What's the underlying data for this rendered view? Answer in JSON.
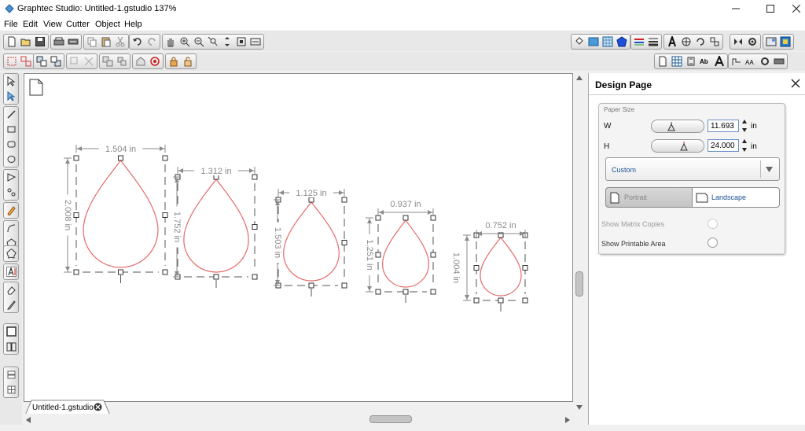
{
  "window": {
    "title": "Graphtec Studio: Untitled-1.gstudio 137%"
  },
  "menu": [
    "File",
    "Edit",
    "View",
    "Cutter",
    "Object",
    "Help"
  ],
  "document": {
    "tab_label": "Untitled-1.gstudio"
  },
  "panel": {
    "title": "Design Page",
    "paper_size_label": "Paper Size",
    "width_label": "W",
    "width_value": "11.693",
    "height_label": "H",
    "height_value": "24.000",
    "unit": "in",
    "preset": "Custom",
    "orientation": {
      "portrait": "Portrait",
      "landscape": "Landscape",
      "selected": "Portrait"
    },
    "show_matrix_copies": "Show Matrix Copies",
    "show_printable_area": "Show Printable Area"
  },
  "shapes": [
    {
      "width_label": "1.504 in",
      "height_label": "2.008 in"
    },
    {
      "width_label": "1.312 in",
      "height_label": "1.752 in"
    },
    {
      "width_label": "1.125 in",
      "height_label": "1.503 in"
    },
    {
      "width_label": "0.937 in",
      "height_label": "1.251 in"
    },
    {
      "width_label": "0.752 in",
      "height_label": "1.004 in"
    }
  ],
  "colors": {
    "shape_stroke": "#e56a6a",
    "dimension_text": "#8a8a8a",
    "accent": "#0a64d8"
  }
}
